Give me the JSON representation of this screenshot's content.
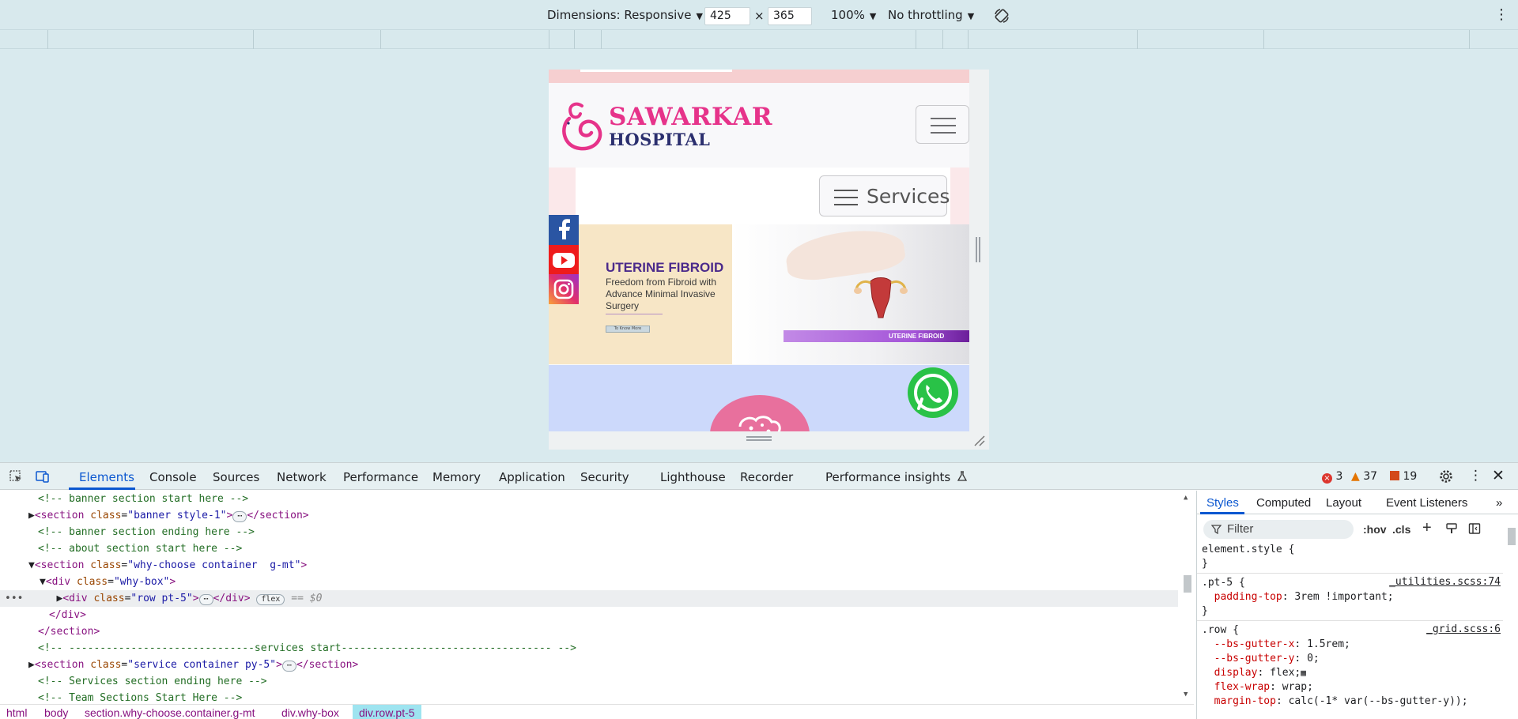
{
  "device_toolbar": {
    "dimensions_label": "Dimensions: Responsive",
    "width_value": "425",
    "times_sign": "×",
    "height_value": "365",
    "zoom": "100%",
    "throttling": "No throttling"
  },
  "site": {
    "logo_line1": "SAWARKAR",
    "logo_line2": "HOSPITAL",
    "services_button": "Services",
    "banner_title": "UTERINE FIBROID",
    "banner_subtitle": "Freedom from Fibroid with Advance Minimal Invasive Surgery",
    "banner_button": "To Know More",
    "banner_strip_label": "UTERINE FIBROID",
    "brand_pink": "#e6338a",
    "brand_navy": "#2b2f6e"
  },
  "devtools": {
    "tabs": [
      "Elements",
      "Console",
      "Sources",
      "Network",
      "Performance",
      "Memory",
      "Application",
      "Security",
      "Lighthouse",
      "Recorder",
      "Performance insights"
    ],
    "errors": "3",
    "warnings": "37",
    "issues": "19",
    "elements_lines": [
      {
        "kind": "comment",
        "text": "<!-- banner section start here -->"
      },
      {
        "kind": "node",
        "text_open": "<section",
        "attr": "class",
        "value": "\"banner style-1\"",
        "text_close": "></section>"
      },
      {
        "kind": "comment",
        "text": "<!-- banner section ending here -->"
      },
      {
        "kind": "comment",
        "text": "<!-- about section start here -->"
      },
      {
        "kind": "node",
        "text_open": "<section",
        "attr": "class",
        "value": "\"why-choose container  g-mt\"",
        "text_close": ">"
      },
      {
        "kind": "node",
        "text_open": "<div",
        "attr": "class",
        "value": "\"why-box\"",
        "text_close": ">"
      },
      {
        "kind": "node",
        "text_open": "<div",
        "attr": "class",
        "value": "\"row pt-5\"",
        "text_close": "></div>",
        "pill": "flex",
        "suffix": "== $0"
      },
      {
        "kind": "close",
        "text": "</div>"
      },
      {
        "kind": "close",
        "text": "</section>"
      },
      {
        "kind": "comment",
        "text": "<!-- ------------------------------services start---------------------------------- -->"
      },
      {
        "kind": "node",
        "text_open": "<section",
        "attr": "class",
        "value": "\"service container py-5\"",
        "text_close": "></section>"
      },
      {
        "kind": "comment",
        "text": "<!-- Services section ending here -->"
      },
      {
        "kind": "comment",
        "text": "<!-- Team Sections Start Here -->"
      }
    ],
    "breadcrumbs": [
      "html",
      "body",
      "section.why-choose.container.g-mt",
      "div.why-box",
      "div.row.pt-5"
    ],
    "styles_tabs": [
      "Styles",
      "Computed",
      "Layout",
      "Event Listeners"
    ],
    "filter_placeholder": "Filter",
    "hov": ":hov",
    "cls": ".cls",
    "rules": [
      {
        "selector": "element.style {",
        "close": "}"
      },
      {
        "selector": ".pt-5 {",
        "source": "_utilities.scss:74",
        "props": [
          {
            "name": "padding-top",
            "value": "3rem !important;"
          }
        ],
        "close": "}"
      },
      {
        "selector": ".row {",
        "source": "_grid.scss:6",
        "props": [
          {
            "name": "--bs-gutter-x",
            "value": "1.5rem;"
          },
          {
            "name": "--bs-gutter-y",
            "value": "0;"
          },
          {
            "name": "display",
            "value": "flex;"
          },
          {
            "name": "flex-wrap",
            "value": "wrap;"
          },
          {
            "name": "margin-top",
            "value": "calc(-1* var(--bs-gutter-y));"
          }
        ]
      }
    ]
  }
}
